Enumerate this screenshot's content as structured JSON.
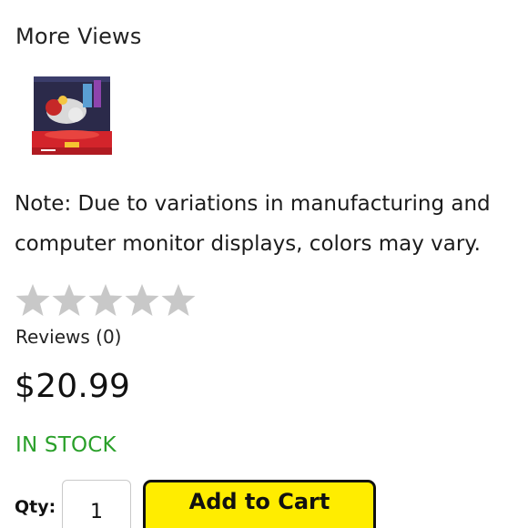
{
  "more_views": {
    "title": "More Views",
    "thumbnails": [
      {
        "icon": "product-thumbnail-image"
      }
    ]
  },
  "note": "Note: Due to variations in manufacturing and computer monitor displays, colors may vary.",
  "rating": {
    "stars_total": 5,
    "stars_filled": 0,
    "reviews_label": "Reviews (0)",
    "star_color": "#c8c8c8"
  },
  "price": "$20.99",
  "stock": {
    "label": "IN STOCK",
    "color": "#2aa02a"
  },
  "cart": {
    "qty_label": "Qty:",
    "qty_value": "1",
    "add_label": "Add to Cart",
    "button_color": "#ffed00"
  }
}
